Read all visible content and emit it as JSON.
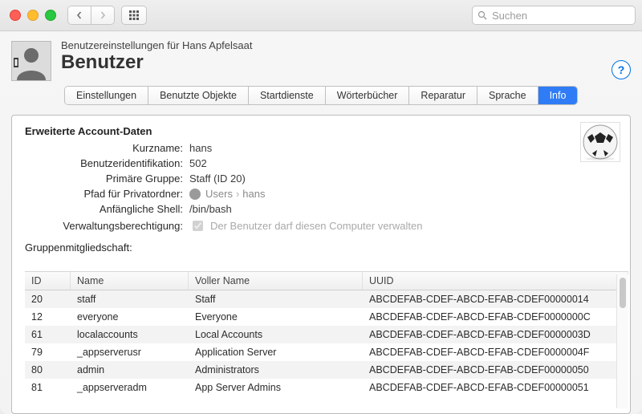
{
  "search": {
    "placeholder": "Suchen"
  },
  "header": {
    "subtitle": "Benutzereinstellungen für Hans Apfelsaat",
    "title": "Benutzer",
    "help": "?"
  },
  "tabs": [
    {
      "label": "Einstellungen"
    },
    {
      "label": "Benutzte Objekte"
    },
    {
      "label": "Startdienste"
    },
    {
      "label": "Wörterbücher"
    },
    {
      "label": "Reparatur"
    },
    {
      "label": "Sprache"
    },
    {
      "label": "Info"
    }
  ],
  "section_title": "Erweiterte Account-Daten",
  "fields": {
    "kurzname": {
      "label": "Kurzname:",
      "value": "hans"
    },
    "uid": {
      "label": "Benutzeridentifikation:",
      "value": "502"
    },
    "pgroup": {
      "label": "Primäre Gruppe:",
      "value": "Staff (ID 20)"
    },
    "homedir": {
      "label": "Pfad für Privatordner:",
      "crumb1": "Users",
      "crumb2": "hans"
    },
    "shell": {
      "label": "Anfängliche Shell:",
      "value": "/bin/bash"
    },
    "admin": {
      "label": "Verwaltungsberechtigung:",
      "text": "Der Benutzer darf diesen Computer verwalten"
    }
  },
  "group_section": "Gruppenmitgliedschaft:",
  "columns": {
    "id": "ID",
    "name": "Name",
    "full": "Voller Name",
    "uuid": "UUID"
  },
  "rows": [
    {
      "id": "20",
      "name": "staff",
      "full": "Staff",
      "uuid": "ABCDEFAB-CDEF-ABCD-EFAB-CDEF00000014"
    },
    {
      "id": "12",
      "name": "everyone",
      "full": "Everyone",
      "uuid": "ABCDEFAB-CDEF-ABCD-EFAB-CDEF0000000C"
    },
    {
      "id": "61",
      "name": "localaccounts",
      "full": "Local Accounts",
      "uuid": "ABCDEFAB-CDEF-ABCD-EFAB-CDEF0000003D"
    },
    {
      "id": "79",
      "name": "_appserverusr",
      "full": "Application Server",
      "uuid": "ABCDEFAB-CDEF-ABCD-EFAB-CDEF0000004F"
    },
    {
      "id": "80",
      "name": "admin",
      "full": "Administrators",
      "uuid": "ABCDEFAB-CDEF-ABCD-EFAB-CDEF00000050"
    },
    {
      "id": "81",
      "name": "_appserveradm",
      "full": "App Server Admins",
      "uuid": "ABCDEFAB-CDEF-ABCD-EFAB-CDEF00000051"
    }
  ]
}
